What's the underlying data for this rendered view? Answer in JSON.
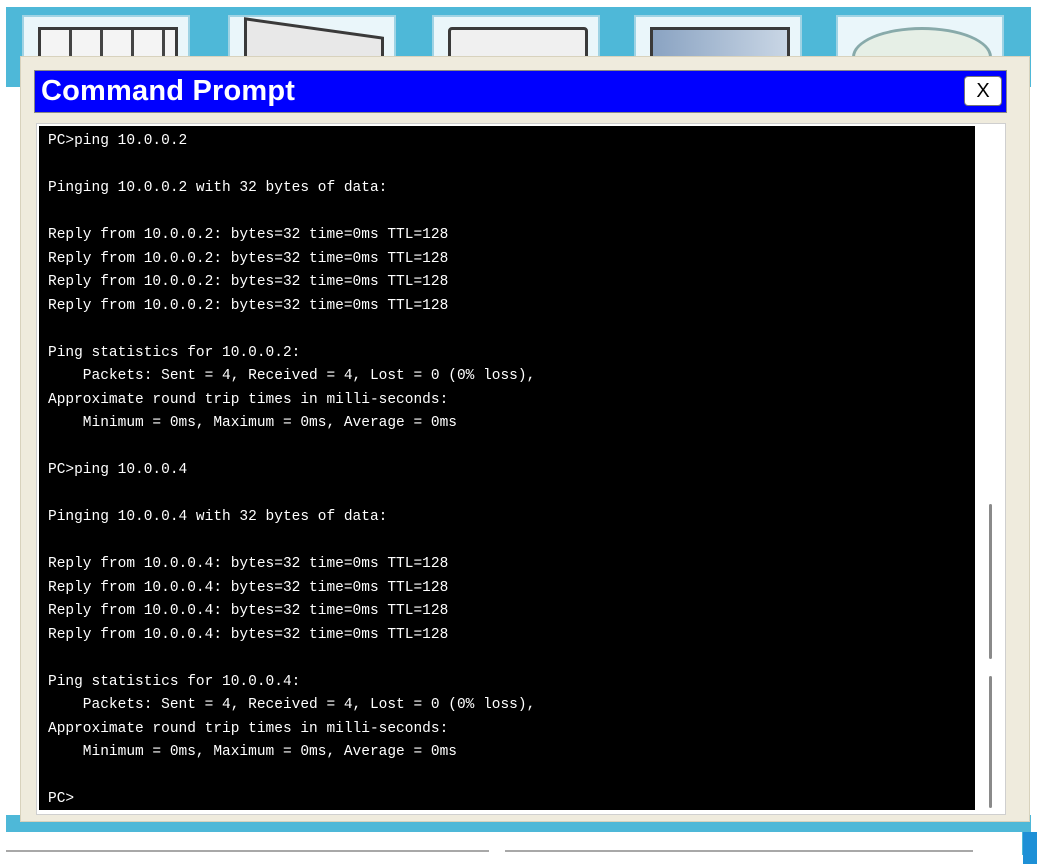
{
  "window": {
    "title": "Command Prompt",
    "close_label": "X"
  },
  "terminal": {
    "lines": [
      "PC>ping 10.0.0.2",
      "",
      "Pinging 10.0.0.2 with 32 bytes of data:",
      "",
      "Reply from 10.0.0.2: bytes=32 time=0ms TTL=128",
      "Reply from 10.0.0.2: bytes=32 time=0ms TTL=128",
      "Reply from 10.0.0.2: bytes=32 time=0ms TTL=128",
      "Reply from 10.0.0.2: bytes=32 time=0ms TTL=128",
      "",
      "Ping statistics for 10.0.0.2:",
      "    Packets: Sent = 4, Received = 4, Lost = 0 (0% loss),",
      "Approximate round trip times in milli-seconds:",
      "    Minimum = 0ms, Maximum = 0ms, Average = 0ms",
      "",
      "PC>ping 10.0.0.4",
      "",
      "Pinging 10.0.0.4 with 32 bytes of data:",
      "",
      "Reply from 10.0.0.4: bytes=32 time=0ms TTL=128",
      "Reply from 10.0.0.4: bytes=32 time=0ms TTL=128",
      "Reply from 10.0.0.4: bytes=32 time=0ms TTL=128",
      "Reply from 10.0.0.4: bytes=32 time=0ms TTL=128",
      "",
      "Ping statistics for 10.0.0.4:",
      "    Packets: Sent = 4, Received = 4, Lost = 0 (0% loss),",
      "Approximate round trip times in milli-seconds:",
      "    Minimum = 0ms, Maximum = 0ms, Average = 0ms",
      "",
      "PC>"
    ]
  },
  "backdrop": {
    "app_icons": [
      "pc-icon",
      "laptop-icon",
      "server-icon",
      "tablet-icon",
      "cloud-icon"
    ]
  },
  "colors": {
    "title_bar": "#0000ff",
    "terminal_bg": "#000000",
    "terminal_text": "#ffffff",
    "window_bg": "#efebdd",
    "backdrop": "#4eb8d8"
  }
}
